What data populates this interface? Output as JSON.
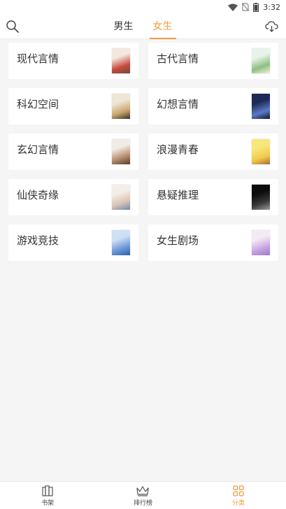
{
  "status_bar": {
    "time": "3:32"
  },
  "header": {
    "tabs": [
      {
        "label": "男生",
        "active": false
      },
      {
        "label": "女生",
        "active": true
      }
    ]
  },
  "categories": [
    {
      "label": "现代言情",
      "cover_colors": [
        "#f3e7df",
        "#c94a3b",
        "#6d4a3e"
      ]
    },
    {
      "label": "古代言情",
      "cover_colors": [
        "#e9f2e8",
        "#8bc080",
        "#f6f1d8"
      ]
    },
    {
      "label": "科幻空间",
      "cover_colors": [
        "#eee6d6",
        "#c9a66c",
        "#3a2f2b"
      ]
    },
    {
      "label": "幻想言情",
      "cover_colors": [
        "#1d2a55",
        "#5b7bc7",
        "#0f1530"
      ]
    },
    {
      "label": "玄幻言情",
      "cover_colors": [
        "#f1ece5",
        "#b58b6b",
        "#5a3d2c"
      ]
    },
    {
      "label": "浪漫青春",
      "cover_colors": [
        "#f7e77a",
        "#f2c94c",
        "#b06a3a"
      ]
    },
    {
      "label": "仙侠奇缘",
      "cover_colors": [
        "#f4eee8",
        "#d7c2b2",
        "#6a8ab3"
      ]
    },
    {
      "label": "悬疑推理",
      "cover_colors": [
        "#0d0d0d",
        "#3a3a3a",
        "#9a9a9a"
      ]
    },
    {
      "label": "游戏竞技",
      "cover_colors": [
        "#cfe0f5",
        "#6b98d6",
        "#2f5da8"
      ]
    },
    {
      "label": "女生剧场",
      "cover_colors": [
        "#f4eaf6",
        "#c9a4e3",
        "#9b7bc8"
      ]
    }
  ],
  "bottom_nav": [
    {
      "label": "书架",
      "icon": "bookshelf-icon",
      "active": false
    },
    {
      "label": "排行榜",
      "icon": "crown-icon",
      "active": false
    },
    {
      "label": "分类",
      "icon": "grid-icon",
      "active": true
    }
  ],
  "colors": {
    "accent": "#f29b3d",
    "background": "#f5f5f5",
    "card": "#ffffff"
  }
}
